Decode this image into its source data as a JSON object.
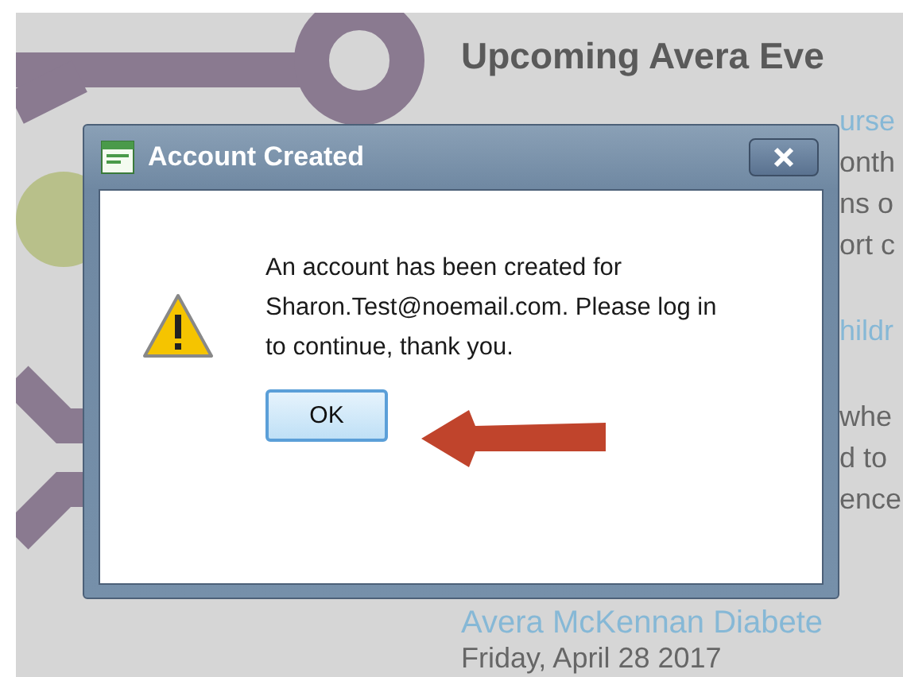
{
  "page": {
    "heading": "Upcoming Avera Eve",
    "fragments": [
      {
        "text": "urse",
        "kind": "link"
      },
      {
        "text": "onth",
        "kind": "text"
      },
      {
        "text": "ns o",
        "kind": "text"
      },
      {
        "text": "ort c",
        "kind": "text"
      },
      {
        "text": "hildr",
        "kind": "link"
      },
      {
        "text": "whe",
        "kind": "text"
      },
      {
        "text": "d to",
        "kind": "text"
      },
      {
        "text": "ence",
        "kind": "text"
      }
    ],
    "event_title": "Avera McKennan Diabete",
    "event_date": "Friday, April 28 2017"
  },
  "dialog": {
    "title": "Account Created",
    "message": "An account has been created for Sharon.Test@noemail.com. Please log in to continue, thank you.",
    "button": "OK"
  }
}
